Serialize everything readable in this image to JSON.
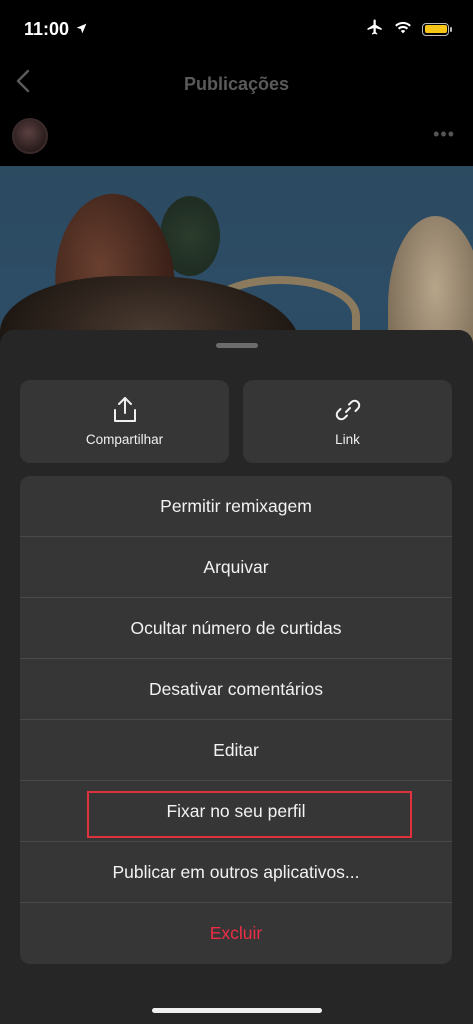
{
  "status_bar": {
    "time": "11:00",
    "icons": [
      "location-arrow-icon",
      "airplane-icon",
      "wifi-icon",
      "battery-icon"
    ],
    "battery_color": "#f5c518"
  },
  "nav": {
    "subtitle": " ",
    "title": "Publicações"
  },
  "post": {
    "username": " "
  },
  "sheet": {
    "actions": [
      {
        "label": "Compartilhar",
        "icon": "share-icon"
      },
      {
        "label": "Link",
        "icon": "link-icon"
      }
    ],
    "menu": [
      {
        "label": "Permitir remixagem"
      },
      {
        "label": "Arquivar"
      },
      {
        "label": "Ocultar número de curtidas"
      },
      {
        "label": "Desativar comentários"
      },
      {
        "label": "Editar"
      },
      {
        "label": "Fixar no seu perfil",
        "highlighted": true
      },
      {
        "label": "Publicar em outros aplicativos..."
      },
      {
        "label": "Excluir",
        "danger": true
      }
    ]
  },
  "colors": {
    "sheet_bg": "#262626",
    "item_bg": "#363636",
    "danger": "#ed2d45",
    "highlight_box": "#e0323e"
  }
}
